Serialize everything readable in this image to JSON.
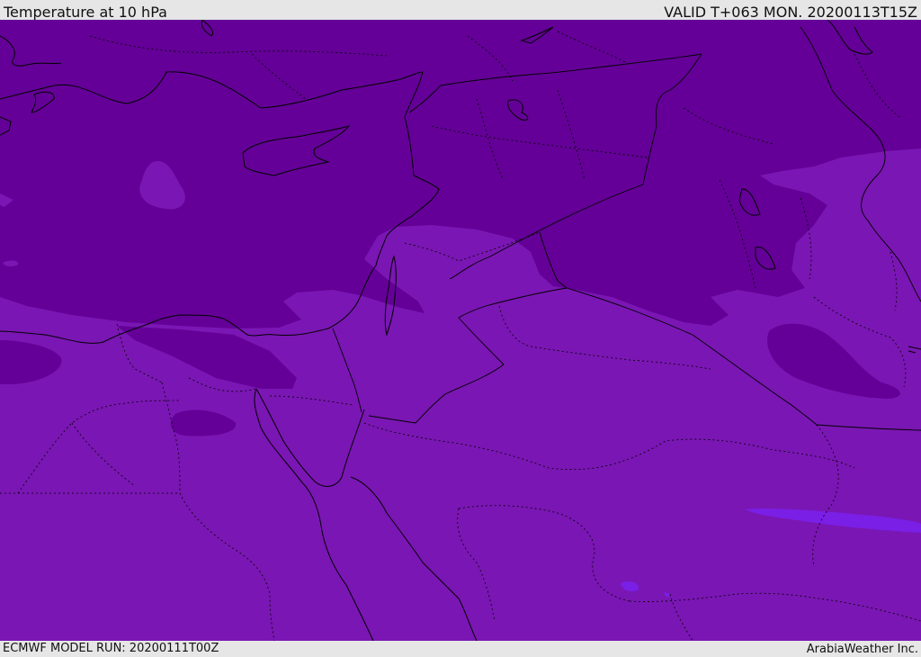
{
  "header": {
    "title": "Temperature at 10 hPa",
    "valid_time": "VALID T+063 MON. 20200113T15Z"
  },
  "footer": {
    "model_run": "ECMWF MODEL RUN: 20200111T00Z",
    "credit": "ArabiaWeather Inc."
  },
  "map": {
    "region": "Eastern Mediterranean and Middle East",
    "colors": {
      "field_warm": "#7a16b3",
      "field_cool": "#640097",
      "field_coldest": "#56008a",
      "field_warmest": "#7a1fe6",
      "coastline": "#000000",
      "border": "#000000"
    }
  }
}
